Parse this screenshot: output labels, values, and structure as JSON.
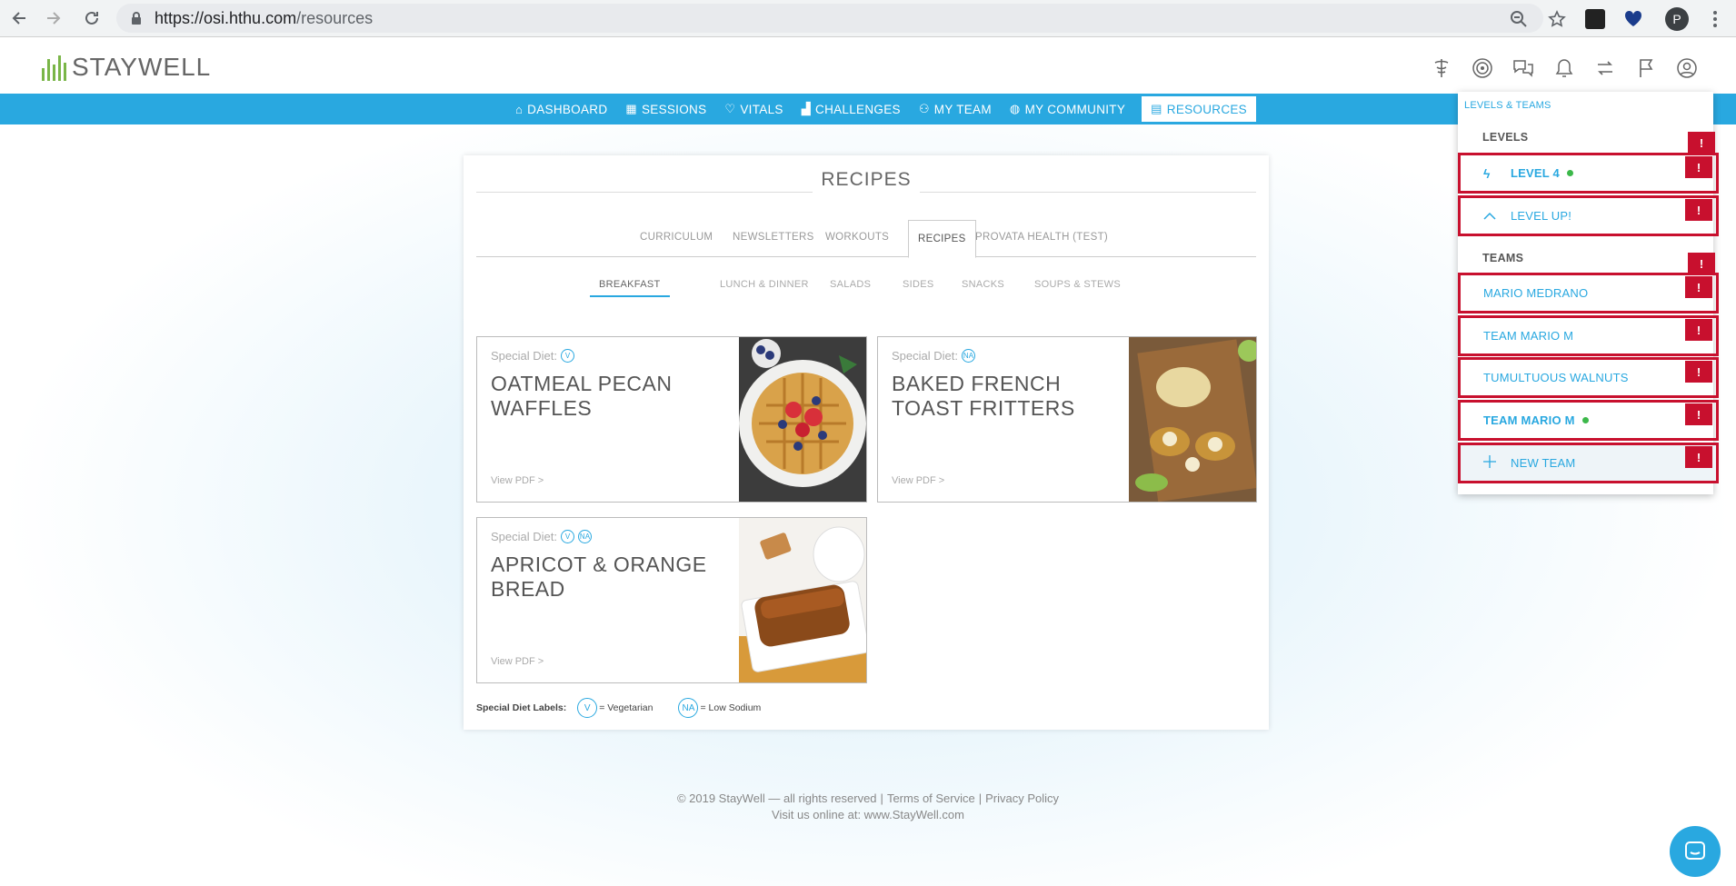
{
  "browser": {
    "url_host": "https://osi.hthu.com",
    "url_path": "/resources",
    "profile_initial": "P"
  },
  "brand": {
    "logo_text": "STAYWELL",
    "accent": "#29a8e0",
    "green": "#7ab648",
    "error": "#c8102e"
  },
  "nav": {
    "items": [
      {
        "label": "DASHBOARD",
        "icon": "home-icon"
      },
      {
        "label": "SESSIONS",
        "icon": "calendar-icon"
      },
      {
        "label": "VITALS",
        "icon": "heart-icon"
      },
      {
        "label": "CHALLENGES",
        "icon": "chart-icon"
      },
      {
        "label": "MY TEAM",
        "icon": "team-icon"
      },
      {
        "label": "MY COMMUNITY",
        "icon": "community-icon"
      },
      {
        "label": "RESOURCES",
        "icon": "resources-icon"
      }
    ]
  },
  "card": {
    "title": "RECIPES",
    "tabs": [
      "CURRICULUM",
      "NEWSLETTERS",
      "WORKOUTS",
      "RECIPES",
      "PROVATA HEALTH (TEST)"
    ],
    "active_tab": "RECIPES",
    "subtabs": [
      "BREAKFAST",
      "LUNCH & DINNER",
      "SALADS",
      "SIDES",
      "SNACKS",
      "SOUPS & STEWS"
    ],
    "active_subtab": "BREAKFAST",
    "diet_label": "Special Diet:",
    "view_pdf": "View PDF >",
    "recipes": [
      {
        "title": "OATMEAL PECAN WAFFLES",
        "badges": [
          "V"
        ]
      },
      {
        "title": "BAKED FRENCH TOAST FRITTERS",
        "badges": [
          "NA"
        ]
      },
      {
        "title": "APRICOT & ORANGE BREAD",
        "badges": [
          "V",
          "NA"
        ]
      }
    ],
    "legend": {
      "label": "Special Diet Labels:",
      "v_badge": "V",
      "v_text": "= Vegetarian",
      "na_badge": "NA",
      "na_text": "= Low Sodium"
    }
  },
  "footer": {
    "copyright": "© 2019 StayWell — all rights reserved",
    "terms": "Terms of Service",
    "privacy": "Privacy Policy",
    "visit": "Visit us online at: www.StayWell.com"
  },
  "dropdown": {
    "header": "LEVELS & TEAMS",
    "levels_heading": "LEVELS",
    "teams_heading": "TEAMS",
    "level_current": "LEVEL 4",
    "level_up": "LEVEL UP!",
    "teams": [
      "MARIO MEDRANO",
      "TEAM MARIO M",
      "TUMULTUOUS WALNUTS",
      "TEAM MARIO M"
    ],
    "new_team": "NEW TEAM",
    "error_mark": "!"
  }
}
